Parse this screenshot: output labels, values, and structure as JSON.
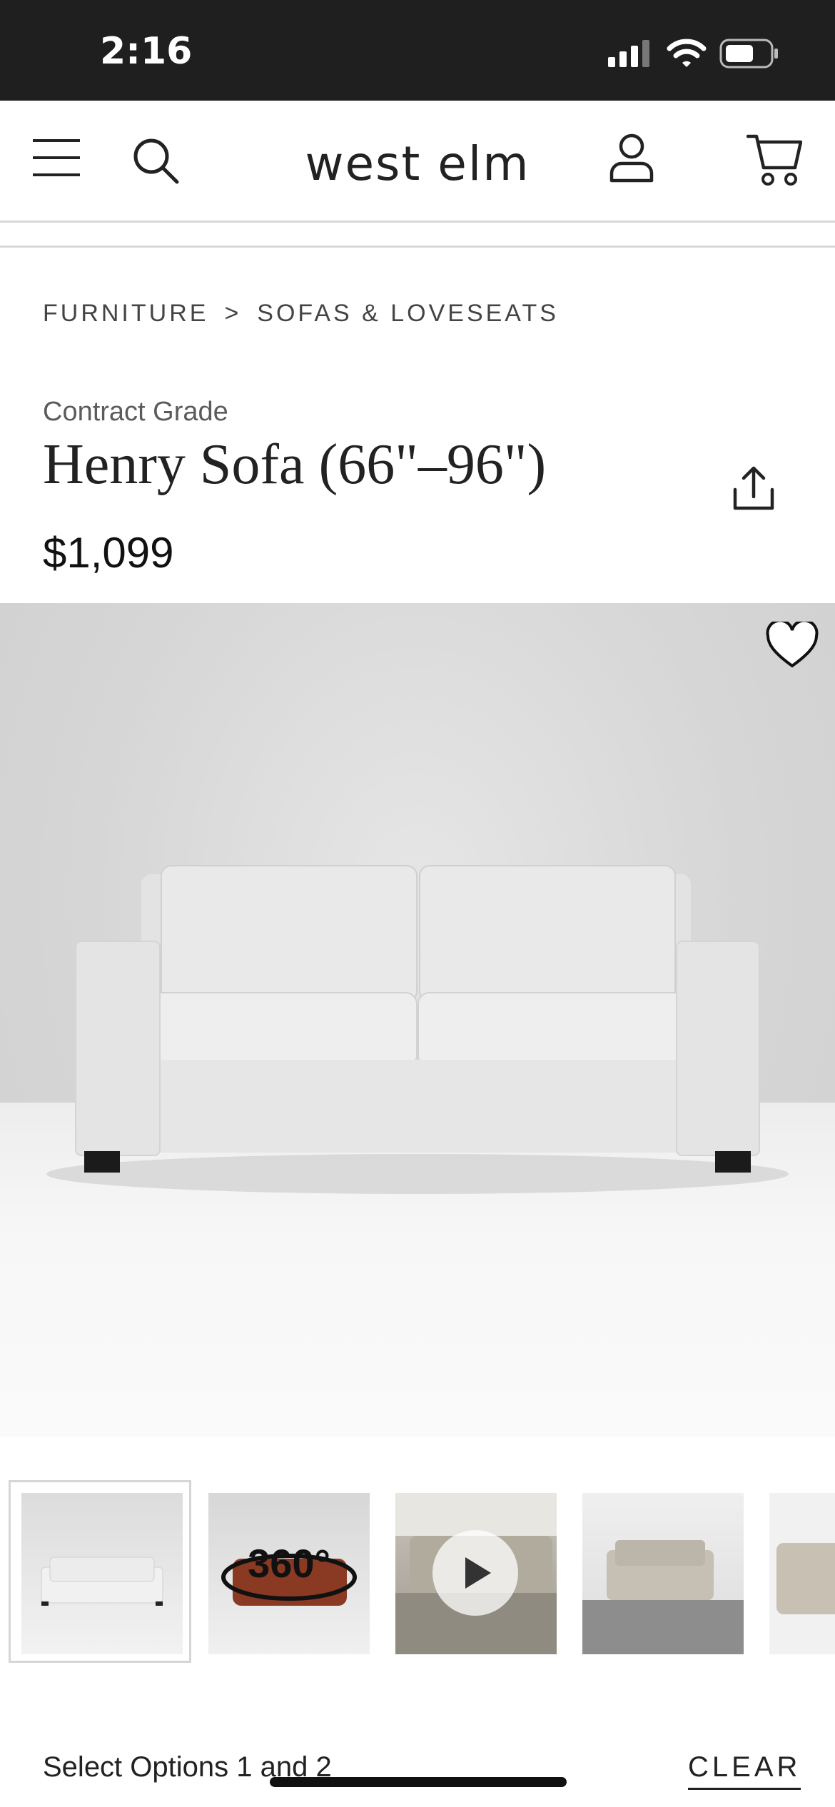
{
  "status_bar": {
    "time": "2:16"
  },
  "header": {
    "brand": "west elm",
    "menu_icon": "hamburger-menu-icon",
    "search_icon": "search-icon",
    "account_icon": "user-icon",
    "cart_icon": "cart-icon"
  },
  "breadcrumb": {
    "items": [
      "FURNITURE",
      "SOFAS & LOVESEATS"
    ],
    "separator": ">"
  },
  "product": {
    "eyebrow": "Contract Grade",
    "title": "Henry Sofa (66\"–96\")",
    "price": "$1,099",
    "share_icon": "share-icon",
    "favorite_icon": "heart-icon"
  },
  "thumbnails": {
    "items": [
      {
        "kind": "image",
        "label": ""
      },
      {
        "kind": "360",
        "label": "360°"
      },
      {
        "kind": "video",
        "label": ""
      },
      {
        "kind": "image",
        "label": ""
      },
      {
        "kind": "image",
        "label": ""
      }
    ]
  },
  "options": {
    "prompt": "Select Options 1 and 2",
    "clear_label": "CLEAR"
  },
  "colors": {
    "status_bar": "#1f1f1f",
    "divider": "#d8d8d8",
    "text": "#222222"
  }
}
